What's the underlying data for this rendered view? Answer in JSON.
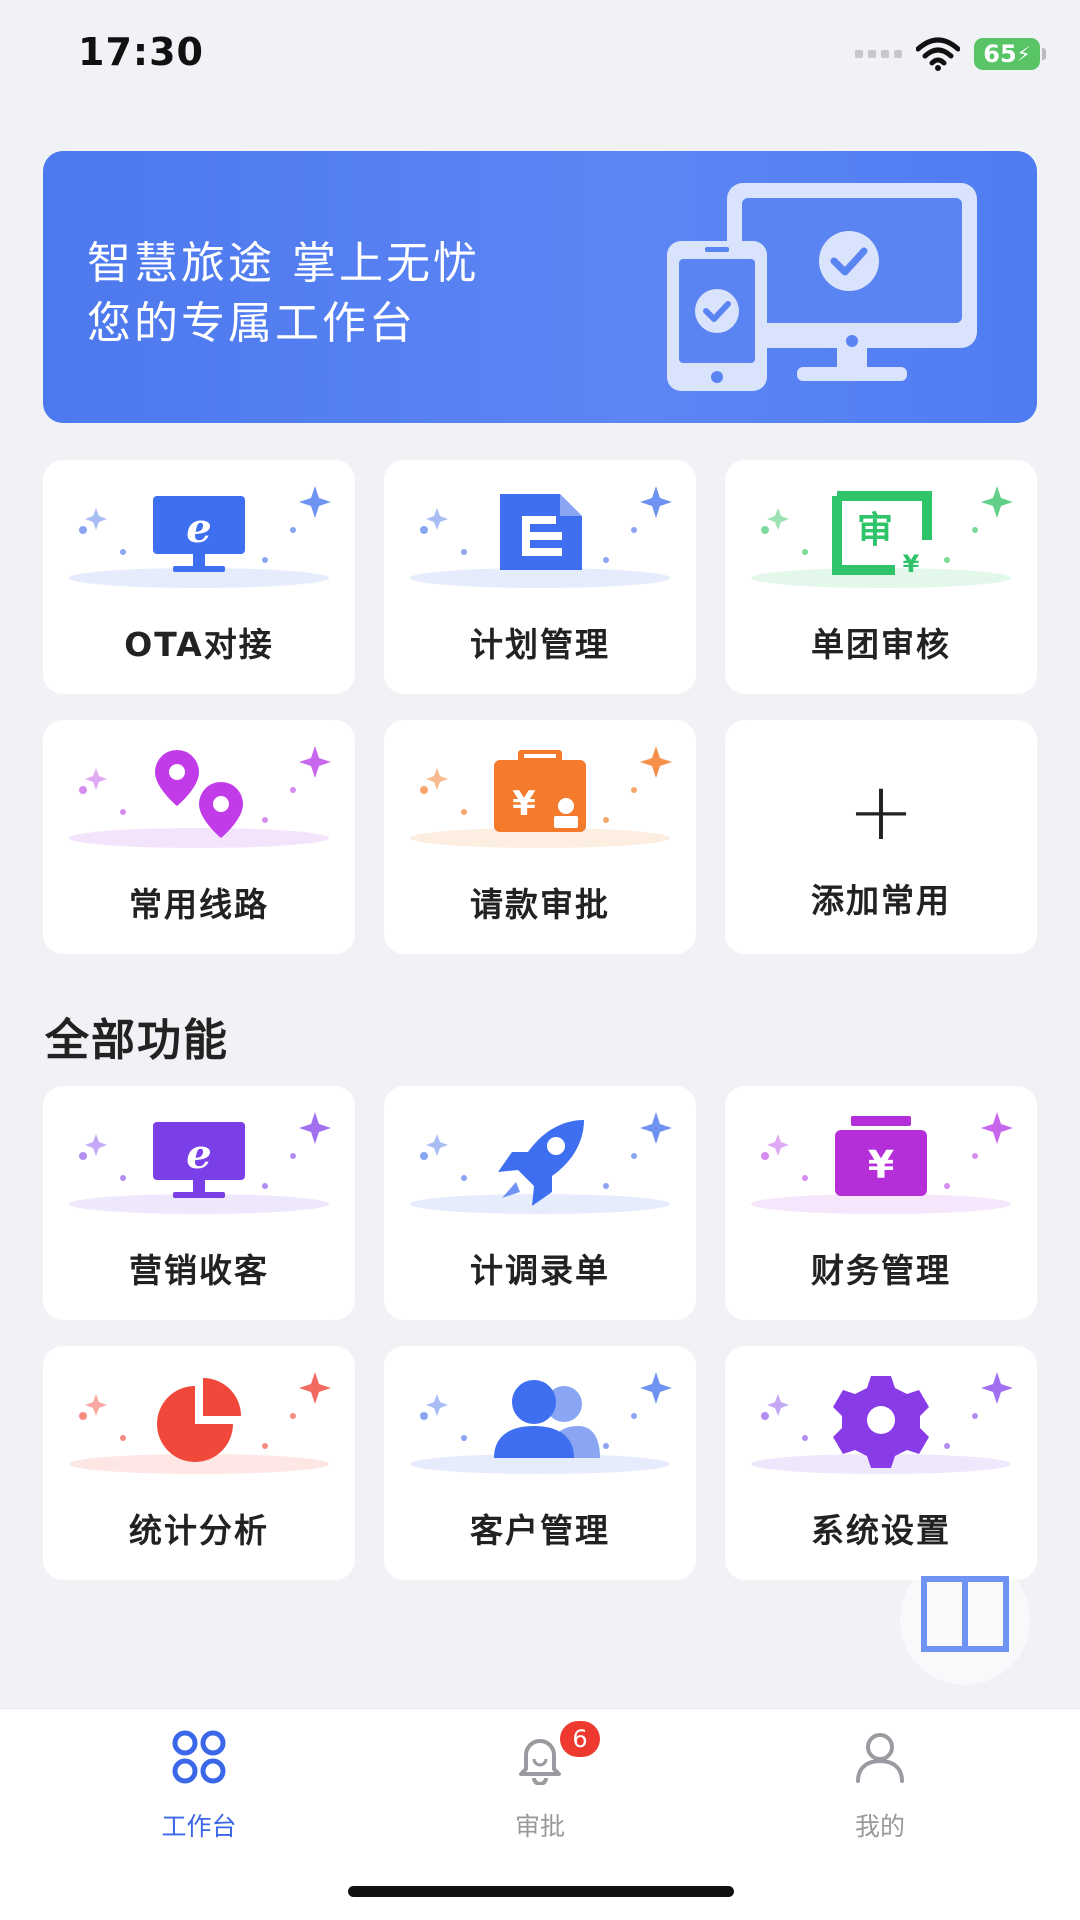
{
  "status_bar": {
    "time": "17:30",
    "battery": "65"
  },
  "banner": {
    "line1": "智慧旅途 掌上无忧",
    "line2": "您的专属工作台"
  },
  "favorites": [
    {
      "label": "OTA对接",
      "icon": "computer-ie-icon",
      "color": "#3d6ff0"
    },
    {
      "label": "计划管理",
      "icon": "document-icon",
      "color": "#3d6ff0"
    },
    {
      "label": "单团审核",
      "icon": "audit-stamp-icon",
      "color": "#2fc46a"
    },
    {
      "label": "常用线路",
      "icon": "map-pin-icon",
      "color": "#c23be8"
    },
    {
      "label": "请款审批",
      "icon": "payment-request-icon",
      "color": "#f47b2b"
    },
    {
      "label": "添加常用",
      "icon": "plus-icon",
      "color": "#222222"
    }
  ],
  "all_section": {
    "title": "全部功能"
  },
  "all_functions": [
    {
      "label": "营销收客",
      "icon": "computer-ie-icon",
      "color": "#7b3fe8"
    },
    {
      "label": "计调录单",
      "icon": "rocket-icon",
      "color": "#3d6ff0"
    },
    {
      "label": "财务管理",
      "icon": "wallet-yen-icon",
      "color": "#b52fd9"
    },
    {
      "label": "统计分析",
      "icon": "pie-chart-icon",
      "color": "#f1483c"
    },
    {
      "label": "客户管理",
      "icon": "users-icon",
      "color": "#3d6ff0"
    },
    {
      "label": "系统设置",
      "icon": "gear-icon",
      "color": "#8a3be8"
    }
  ],
  "tabbar": {
    "tabs": [
      {
        "label": "工作台",
        "icon": "grid-icon",
        "active": true
      },
      {
        "label": "审批",
        "icon": "bell-icon",
        "badge": "6"
      },
      {
        "label": "我的",
        "icon": "person-icon"
      }
    ]
  },
  "colors": {
    "accent": "#3a68e8",
    "banner": "#4d79ee",
    "badge": "#ee3a2e"
  }
}
